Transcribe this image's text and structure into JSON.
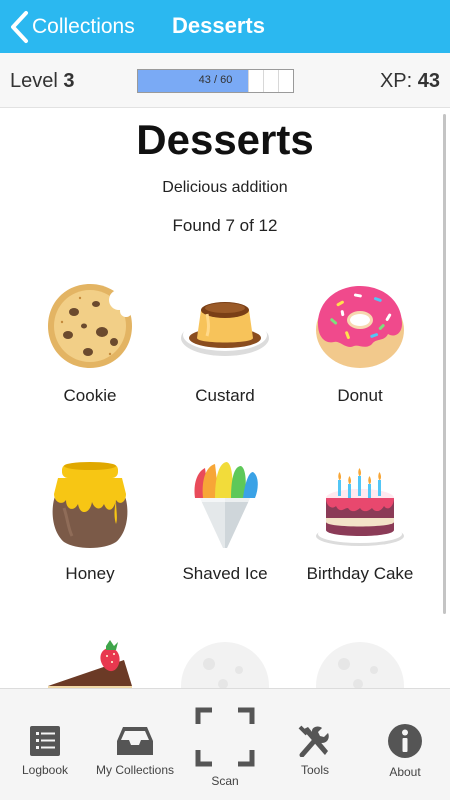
{
  "header": {
    "back_label": "Collections",
    "title": "Desserts",
    "background": "#2bb8f0"
  },
  "level": {
    "label": "Level",
    "value": "3",
    "progress_text": "43 / 60",
    "progress_current": 43,
    "progress_max": 60,
    "xp_label": "XP:",
    "xp_value": "43",
    "progress_color": "#7aaaf5"
  },
  "collection": {
    "title": "Desserts",
    "subtitle": "Delicious addition",
    "found_text": "Found 7 of 12",
    "items": [
      {
        "label": "Cookie",
        "icon": "cookie-icon"
      },
      {
        "label": "Custard",
        "icon": "custard-icon"
      },
      {
        "label": "Donut",
        "icon": "donut-icon"
      },
      {
        "label": "Honey",
        "icon": "honey-pot-icon"
      },
      {
        "label": "Shaved Ice",
        "icon": "shaved-ice-icon"
      },
      {
        "label": "Birthday Cake",
        "icon": "birthday-cake-icon"
      },
      {
        "label": "",
        "icon": "cake-slice-icon"
      },
      {
        "label": "",
        "icon": "locked-placeholder-icon"
      },
      {
        "label": "",
        "icon": "locked-placeholder-icon"
      }
    ]
  },
  "nav": {
    "items": [
      {
        "label": "Logbook",
        "icon": "logbook-icon"
      },
      {
        "label": "My Collections",
        "icon": "inbox-tray-icon"
      },
      {
        "label": "Scan",
        "icon": "scan-frame-icon"
      },
      {
        "label": "Tools",
        "icon": "tools-icon"
      },
      {
        "label": "About",
        "icon": "info-icon"
      }
    ]
  }
}
